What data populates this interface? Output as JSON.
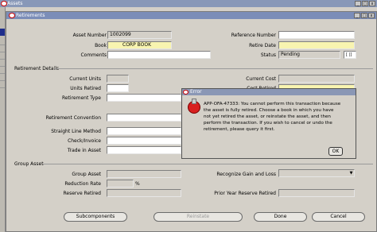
{
  "window": {
    "title": "Assets",
    "minimize": "_",
    "maximize": "□",
    "close": "x"
  },
  "inner_window": {
    "title": "Retirements",
    "minimize": "_",
    "maximize": "□",
    "close": "x"
  },
  "header": {
    "asset_number_label": "Asset Number",
    "asset_number_value": "1002099",
    "book_label": "Book",
    "book_value": "CORP BOOK",
    "comments_label": "Comments",
    "comments_value": "",
    "reference_number_label": "Reference Number",
    "reference_number_value": "",
    "retire_date_label": "Retire Date",
    "retire_date_value": "",
    "status_label": "Status",
    "status_value": "Pending",
    "flex_value": "[ |]"
  },
  "retirement_details": {
    "section_label": "Retirement Details",
    "current_units_label": "Current Units",
    "units_retired_label": "Units Retired",
    "retirement_type_label": "Retirement Type",
    "retirement_convention_label": "Retirement Convention",
    "straight_line_method_label": "Straight Line Method",
    "check_invoice_label": "Check/Invoice",
    "trade_in_asset_label": "Trade in Asset",
    "current_cost_label": "Current Cost",
    "cost_retired_label": "Cost Retired"
  },
  "group_asset": {
    "section_label": "Group Asset",
    "group_asset_label": "Group Asset",
    "reduction_rate_label": "Reduction Rate",
    "percent_symbol": "%",
    "reserve_retired_label": "Reserve Retired",
    "recognize_gain_loss_label": "Recognize Gain and Loss",
    "prior_year_reserve_label": "Prior Year Reserve Retired"
  },
  "buttons": {
    "subcomponents": "Subcomponents",
    "reinstate": "Reinstate",
    "done": "Done",
    "cancel": "Cancel"
  },
  "error_dialog": {
    "title": "Error",
    "message_lines": [
      "APP-OFA-47333: You cannot perform this transaction because",
      "the asset is fully retired.  Choose a book in which you have",
      "not yet retired the asset, or reinstate the asset, and then",
      "perform the transaction.  If you wish to cancel or undo the",
      "retirement, please query it first."
    ],
    "ok_label": "OK"
  },
  "icons": {
    "error": "error-icon",
    "dropdown": "chevron-down-icon",
    "logo": "oracle-logo-icon"
  }
}
